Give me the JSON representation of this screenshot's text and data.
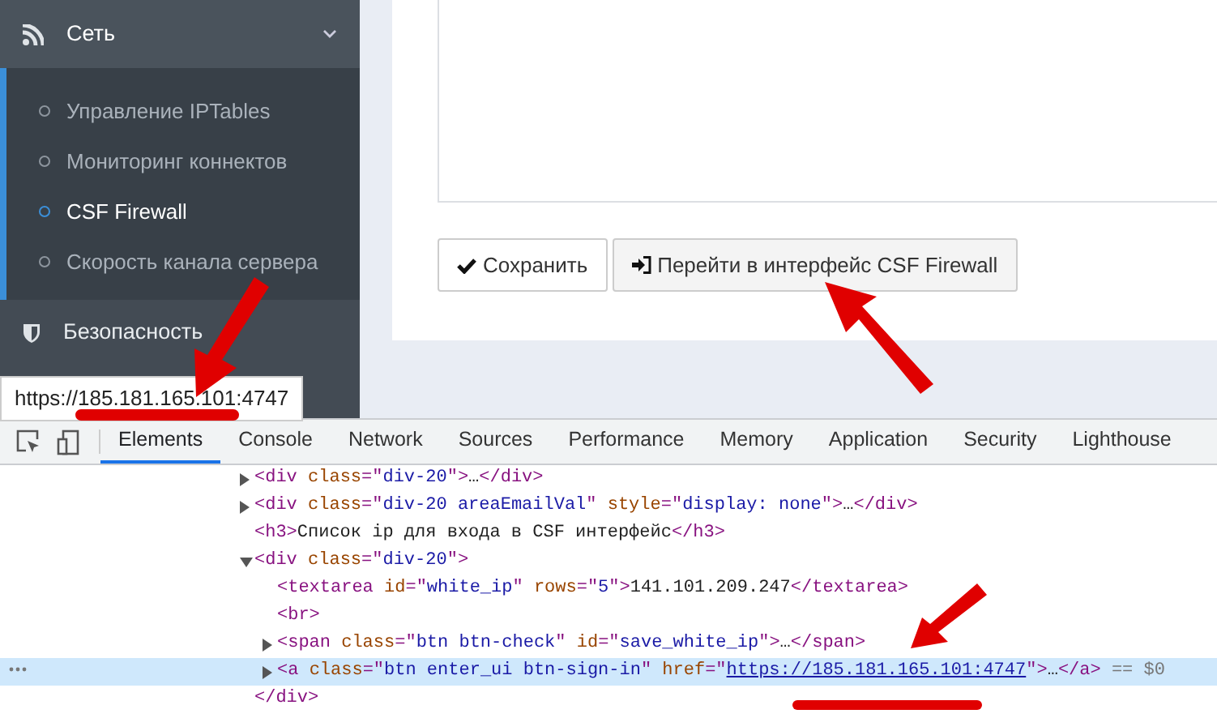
{
  "sidebar": {
    "section": {
      "label": "Сеть",
      "expanded": true
    },
    "items": [
      {
        "label": "Управление IPTables",
        "selected": false
      },
      {
        "label": "Мониторинг коннектов",
        "selected": false
      },
      {
        "label": "CSF Firewall",
        "selected": true
      },
      {
        "label": "Скорость канала сервера",
        "selected": false
      }
    ],
    "next_section": {
      "label": "Безопасность"
    }
  },
  "tooltip": "https://185.181.165.101:4747",
  "buttons": [
    {
      "label": "Сохранить",
      "kind": "check"
    },
    {
      "label": "Перейти в интерфейс CSF Firewall",
      "kind": "sign-in"
    }
  ],
  "devtools": {
    "tabs": [
      {
        "label": "Elements",
        "selected": true
      },
      {
        "label": "Console",
        "selected": false
      },
      {
        "label": "Network",
        "selected": false
      },
      {
        "label": "Sources",
        "selected": false
      },
      {
        "label": "Performance",
        "selected": false
      },
      {
        "label": "Memory",
        "selected": false
      },
      {
        "label": "Application",
        "selected": false
      },
      {
        "label": "Security",
        "selected": false
      },
      {
        "label": "Lighthouse",
        "selected": false
      }
    ],
    "dom_tree": [
      {
        "expanded": false,
        "selected": false,
        "parts": [
          {
            "kind": "tag",
            "text": "<div "
          },
          {
            "kind": "attr",
            "text": "class"
          },
          {
            "kind": "tag",
            "text": "=\""
          },
          {
            "kind": "value",
            "text": "div-20"
          },
          {
            "kind": "tag",
            "text": "\">"
          },
          {
            "kind": "text",
            "text": "…"
          },
          {
            "kind": "tag",
            "text": "</div>"
          }
        ]
      },
      {
        "expanded": false,
        "selected": false,
        "parts": [
          {
            "kind": "tag",
            "text": "<div "
          },
          {
            "kind": "attr",
            "text": "class"
          },
          {
            "kind": "tag",
            "text": "=\""
          },
          {
            "kind": "value",
            "text": "div-20 areaEmailVal"
          },
          {
            "kind": "tag",
            "text": "\" "
          },
          {
            "kind": "attr",
            "text": "style"
          },
          {
            "kind": "tag",
            "text": "=\""
          },
          {
            "kind": "value",
            "text": "display: none"
          },
          {
            "kind": "tag",
            "text": "\">"
          },
          {
            "kind": "text",
            "text": "…"
          },
          {
            "kind": "tag",
            "text": "</div>"
          }
        ]
      },
      {
        "selected": false,
        "parts": [
          {
            "kind": "tag",
            "text": "<h3>"
          },
          {
            "kind": "text",
            "text": "Список ip для входа в CSF интерфейс"
          },
          {
            "kind": "tag",
            "text": "</h3>"
          }
        ]
      },
      {
        "expanded": true,
        "selected": false,
        "parts": [
          {
            "kind": "tag",
            "text": "<div "
          },
          {
            "kind": "attr",
            "text": "class"
          },
          {
            "kind": "tag",
            "text": "=\""
          },
          {
            "kind": "value",
            "text": "div-20"
          },
          {
            "kind": "tag",
            "text": "\">"
          }
        ],
        "closing": "</div>",
        "children": [
          {
            "selected": false,
            "parts": [
              {
                "kind": "tag",
                "text": "<textarea "
              },
              {
                "kind": "attr",
                "text": "id"
              },
              {
                "kind": "tag",
                "text": "=\""
              },
              {
                "kind": "value",
                "text": "white_ip"
              },
              {
                "kind": "tag",
                "text": "\" "
              },
              {
                "kind": "attr",
                "text": "rows"
              },
              {
                "kind": "tag",
                "text": "=\""
              },
              {
                "kind": "value",
                "text": "5"
              },
              {
                "kind": "tag",
                "text": "\">"
              },
              {
                "kind": "text",
                "text": "141.101.209.247"
              },
              {
                "kind": "tag",
                "text": "</textarea>"
              }
            ]
          },
          {
            "selected": false,
            "parts": [
              {
                "kind": "tag",
                "text": "<br>"
              }
            ]
          },
          {
            "expanded": false,
            "selected": false,
            "parts": [
              {
                "kind": "tag",
                "text": "<span "
              },
              {
                "kind": "attr",
                "text": "class"
              },
              {
                "kind": "tag",
                "text": "=\""
              },
              {
                "kind": "value",
                "text": "btn btn-check"
              },
              {
                "kind": "tag",
                "text": "\" "
              },
              {
                "kind": "attr",
                "text": "id"
              },
              {
                "kind": "tag",
                "text": "=\""
              },
              {
                "kind": "value",
                "text": "save_white_ip"
              },
              {
                "kind": "tag",
                "text": "\">"
              },
              {
                "kind": "text",
                "text": "…"
              },
              {
                "kind": "tag",
                "text": "</span>"
              }
            ]
          },
          {
            "expanded": false,
            "selected": true,
            "parts": [
              {
                "kind": "tag",
                "text": "<a "
              },
              {
                "kind": "attr",
                "text": "class"
              },
              {
                "kind": "tag",
                "text": "=\""
              },
              {
                "kind": "value",
                "text": "btn enter_ui btn-sign-in"
              },
              {
                "kind": "tag",
                "text": "\" "
              },
              {
                "kind": "attr",
                "text": "href"
              },
              {
                "kind": "tag",
                "text": "=\""
              },
              {
                "kind": "link",
                "text": "https://185.181.165.101:4747"
              },
              {
                "kind": "tag",
                "text": "\">"
              },
              {
                "kind": "text",
                "text": "…"
              },
              {
                "kind": "tag",
                "text": "</a>"
              },
              {
                "kind": "note",
                "text": " == $0"
              }
            ]
          }
        ]
      }
    ]
  }
}
